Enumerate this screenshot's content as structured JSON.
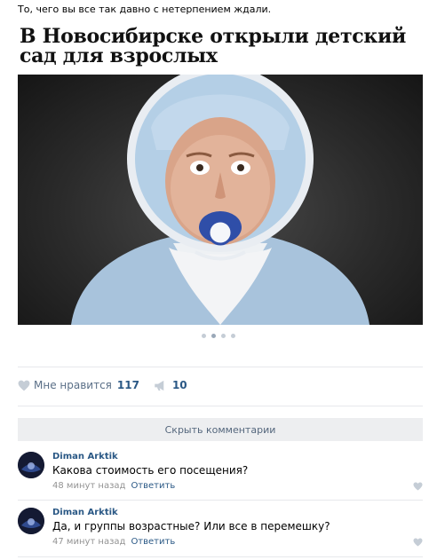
{
  "post": {
    "text": "То, чего вы все так давно с нетерпением ждали.",
    "headline": "В Новосибирске открыли детский сад для взрослых",
    "carousel_dots": 4,
    "carousel_active": 2
  },
  "actions": {
    "like_label": "Мне нравится",
    "like_count": "117",
    "share_count": "10"
  },
  "comments_toggle": "Скрыть комментарии",
  "comments": [
    {
      "author": "Diman Arktik",
      "text": "Какова стоимость его посещения?",
      "time": "48 минут назад",
      "reply": "Ответить"
    },
    {
      "author": "Diman Arktik",
      "text": "Да, и группы возрастные? Или все в перемешку?",
      "time": "47 минут назад",
      "reply": "Ответить"
    }
  ],
  "colors": {
    "link": "#2a5885",
    "muted": "#939393",
    "button_bg": "#edeef0",
    "icon": "#c5cdd6"
  },
  "icons": {
    "like": "heart-icon",
    "share": "megaphone-icon"
  }
}
